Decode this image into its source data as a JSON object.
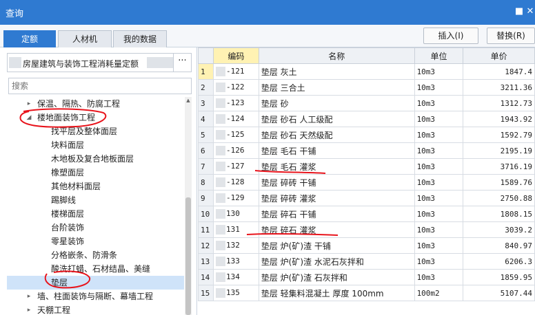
{
  "window": {
    "title": "查询",
    "pin_glyph": "■",
    "close_glyph": "✕"
  },
  "tabs": [
    {
      "label": "定额",
      "active": true
    },
    {
      "label": "人材机",
      "active": false
    },
    {
      "label": "我的数据",
      "active": false
    }
  ],
  "actions": {
    "insert_label": "插入(I)",
    "replace_label": "替换(R)"
  },
  "library": {
    "name": "房屋建筑与装饰工程消耗量定额",
    "more_label": "···"
  },
  "search": {
    "placeholder": "搜索"
  },
  "tree": [
    {
      "label": "保温、隔热、防腐工程",
      "level": 1,
      "expanded": false
    },
    {
      "label": "楼地面装饰工程",
      "level": 1,
      "expanded": true
    },
    {
      "label": "找平层及整体面层",
      "level": 2
    },
    {
      "label": "块料面层",
      "level": 2
    },
    {
      "label": "木地板及复合地板面层",
      "level": 2
    },
    {
      "label": "橡塑面层",
      "level": 2
    },
    {
      "label": "其他材料面层",
      "level": 2
    },
    {
      "label": "踢脚线",
      "level": 2
    },
    {
      "label": "楼梯面层",
      "level": 2
    },
    {
      "label": "台阶装饰",
      "level": 2
    },
    {
      "label": "零星装饰",
      "level": 2
    },
    {
      "label": "分格嵌条、防滑条",
      "level": 2
    },
    {
      "label": "酸洗打蜡、石材结晶、美缝",
      "level": 2
    },
    {
      "label": "垫层",
      "level": 2,
      "selected": true
    },
    {
      "label": "墙、柱面装饰与隔断、幕墙工程",
      "level": 1,
      "expanded": false
    },
    {
      "label": "天棚工程",
      "level": 1,
      "expanded": false
    }
  ],
  "table": {
    "headers": [
      "",
      "编码",
      "名称",
      "单位",
      "单价"
    ],
    "rows": [
      [
        "1",
        "-121",
        "垫层 灰土",
        "10m3",
        "1847.4"
      ],
      [
        "2",
        "-122",
        "垫层 三合土",
        "10m3",
        "3211.36"
      ],
      [
        "3",
        "-123",
        "垫层 砂",
        "10m3",
        "1312.73"
      ],
      [
        "4",
        "-124",
        "垫层 砂石 人工级配",
        "10m3",
        "1943.92"
      ],
      [
        "5",
        "-125",
        "垫层 砂石 天然级配",
        "10m3",
        "1592.79"
      ],
      [
        "6",
        "-126",
        "垫层 毛石 干铺",
        "10m3",
        "2195.19"
      ],
      [
        "7",
        "-127",
        "垫层 毛石 灌浆",
        "10m3",
        "3716.19"
      ],
      [
        "8",
        "-128",
        "垫层 碎砖 干铺",
        "10m3",
        "1589.76"
      ],
      [
        "9",
        "-129",
        "垫层 碎砖 灌浆",
        "10m3",
        "2750.88"
      ],
      [
        "10",
        "130",
        "垫层 碎石 干铺",
        "10m3",
        "1808.15"
      ],
      [
        "11",
        "131",
        "垫层 碎石 灌浆",
        "10m3",
        "3039.2"
      ],
      [
        "12",
        "132",
        "垫层 炉(矿)渣 干铺",
        "10m3",
        "840.97"
      ],
      [
        "13",
        "133",
        "垫层 炉(矿)渣 水泥石灰拌和",
        "10m3",
        "6206.3"
      ],
      [
        "14",
        "134",
        "垫层 炉(矿)渣 石灰拌和",
        "10m3",
        "1859.95"
      ],
      [
        "15",
        "135",
        "垫层 轻集料混凝土 厚度 100mm",
        "100m2",
        "5107.44"
      ]
    ]
  },
  "colors": {
    "accent": "#2f7ad1",
    "annotation": "#e8131b",
    "header_highlight": "#fff2b3",
    "selection": "#cfe3f9"
  }
}
